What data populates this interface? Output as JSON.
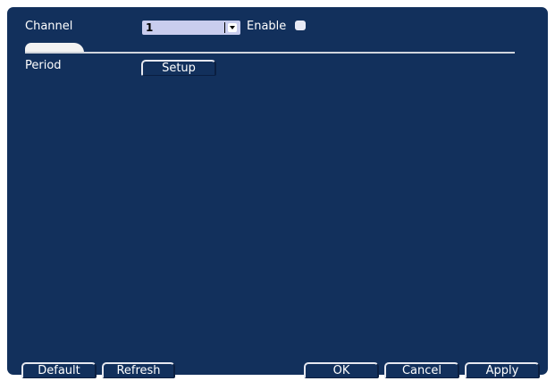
{
  "channel": {
    "label": "Channel",
    "value": "1"
  },
  "enable": {
    "label": "Enable",
    "checked": false
  },
  "period": {
    "label": "Period",
    "setup_label": "Setup"
  },
  "footer": {
    "default_label": "Default",
    "refresh_label": "Refresh",
    "ok_label": "OK",
    "cancel_label": "Cancel",
    "apply_label": "Apply"
  },
  "colors": {
    "panel_background": "#12305c",
    "select_background": "#c9cdee",
    "text": "#ffffff"
  }
}
